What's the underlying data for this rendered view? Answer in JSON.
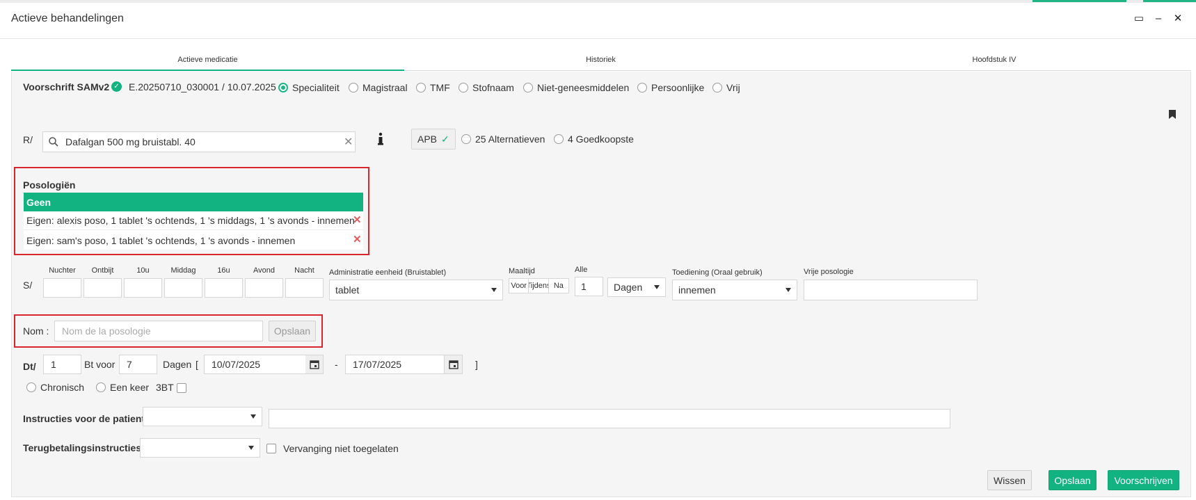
{
  "window": {
    "title": "Actieve behandelingen",
    "maximize_glyph": "▭",
    "minimize_glyph": "–",
    "close_glyph": "✕"
  },
  "tabs": [
    {
      "label": "Actieve medicatie",
      "active": true
    },
    {
      "label": "Historiek",
      "active": false
    },
    {
      "label": "Hoofdstuk IV",
      "active": false
    }
  ],
  "prescription": {
    "label": "Voorschrift SAMv2",
    "id_date": "E.20250710_030001 / 10.07.2025",
    "types": [
      {
        "label": "Specialiteit",
        "selected": true
      },
      {
        "label": "Magistraal",
        "selected": false
      },
      {
        "label": "TMF",
        "selected": false
      },
      {
        "label": "Stofnaam",
        "selected": false
      },
      {
        "label": "Niet-geneesmiddelen",
        "selected": false
      },
      {
        "label": "Persoonlijke",
        "selected": false
      },
      {
        "label": "Vrij",
        "selected": false
      }
    ]
  },
  "product": {
    "label": "R/",
    "search_value": "Dafalgan 500 mg bruistabl. 40",
    "apb_label": "APB",
    "alternatives": "25 Alternatieven",
    "cheapest": "4 Goedkoopste"
  },
  "posologies": {
    "title": "Posologiën",
    "items": [
      {
        "text": "Geen",
        "selected": true,
        "deletable": false
      },
      {
        "text": "Eigen: alexis poso, 1 tablet 's ochtends, 1 's middags, 1 's avonds - innemen",
        "selected": false,
        "deletable": true
      },
      {
        "text": "Eigen: sam's poso, 1 tablet 's ochtends, 1 's avonds - innemen",
        "selected": false,
        "deletable": true
      }
    ]
  },
  "schedule": {
    "label": "S/",
    "moments": [
      "Nuchter",
      "Ontbijt",
      "10u",
      "Middag",
      "16u",
      "Avond",
      "Nacht"
    ],
    "unit_label": "Administratie eenheid  (Bruistablet)",
    "unit_value": "tablet",
    "meal_label": "Maaltijd",
    "meal_options": [
      "Voor",
      "Tijdens",
      "Na"
    ],
    "every_label": "Alle",
    "every_value": "1",
    "every_unit": "Dagen",
    "admin_label": "Toediening (Oraal gebruik)",
    "admin_value": "innemen",
    "free_label": "Vrije posologie",
    "free_value": ""
  },
  "name_row": {
    "label": "Nom :",
    "placeholder": "Nom de la posologie",
    "save": "Opslaan"
  },
  "duration": {
    "label": "Dt/",
    "qty": "1",
    "bt_voor": "Bt voor",
    "days": "7",
    "days_label": "Dagen",
    "open_bracket": "[",
    "start": "10/07/2025",
    "dash": "-",
    "end": "17/07/2025",
    "close_bracket": "]",
    "chronic": "Chronisch",
    "once": "Een keer",
    "bt3": "3BT"
  },
  "instructions": {
    "label": "Instructies voor de patient",
    "select_value": "",
    "text_value": ""
  },
  "reimbursement": {
    "label": "Terugbetalingsinstructies",
    "select_value": "",
    "no_substitution": "Vervanging niet toegelaten"
  },
  "footer": {
    "clear": "Wissen",
    "save": "Opslaan",
    "prescribe": "Voorschrijven"
  },
  "colors": {
    "accent": "#13b381",
    "highlight": "#d9262c"
  }
}
